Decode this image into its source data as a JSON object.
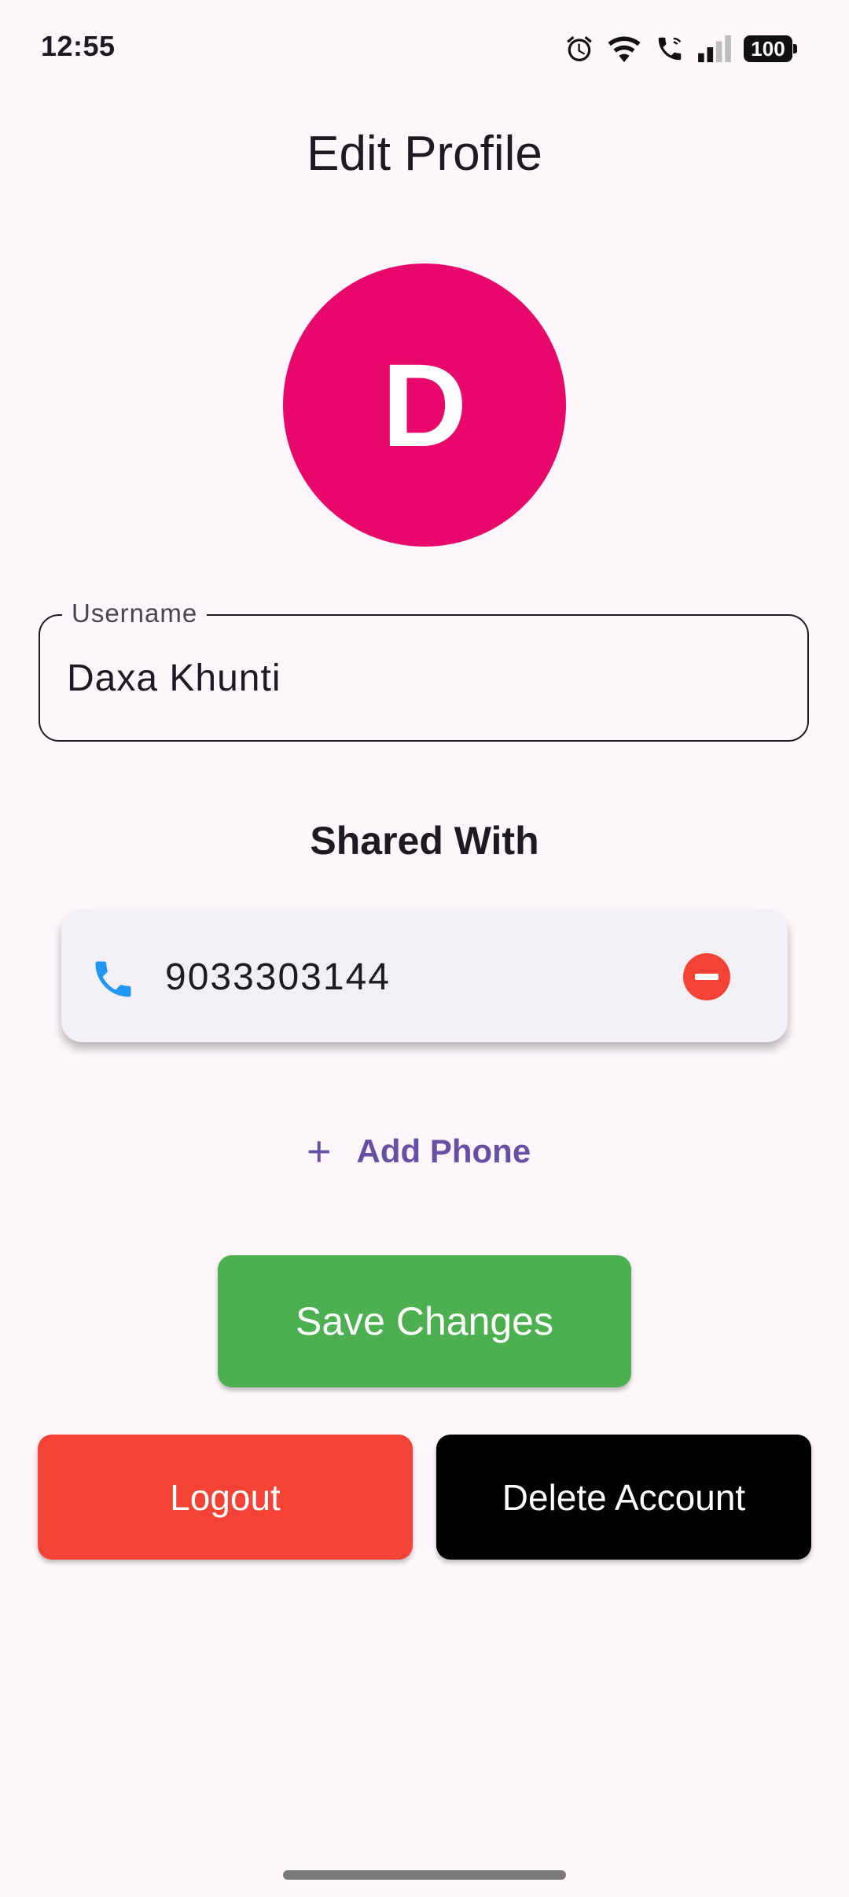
{
  "status_bar": {
    "time": "12:55",
    "battery": "100",
    "icons": [
      "alarm-icon",
      "wifi-icon",
      "wifi-calling-icon",
      "signal-icon",
      "battery-icon"
    ]
  },
  "page": {
    "title": "Edit Profile"
  },
  "avatar": {
    "letter": "D",
    "color": "#e8086b"
  },
  "username": {
    "label": "Username",
    "value": "Daxa Khunti"
  },
  "shared_with": {
    "heading": "Shared With",
    "phones": [
      {
        "number": "9033303144",
        "icon": "phone-icon"
      }
    ]
  },
  "actions": {
    "add_phone": "Add Phone",
    "save": "Save Changes",
    "logout": "Logout",
    "delete": "Delete Account"
  },
  "colors": {
    "background": "#fdf7fc",
    "avatar": "#e8086b",
    "save": "#4caf50",
    "logout": "#f44336",
    "delete": "#000000",
    "accent": "#6750a4",
    "phone_icon": "#2196f3",
    "remove_icon": "#f44336"
  }
}
